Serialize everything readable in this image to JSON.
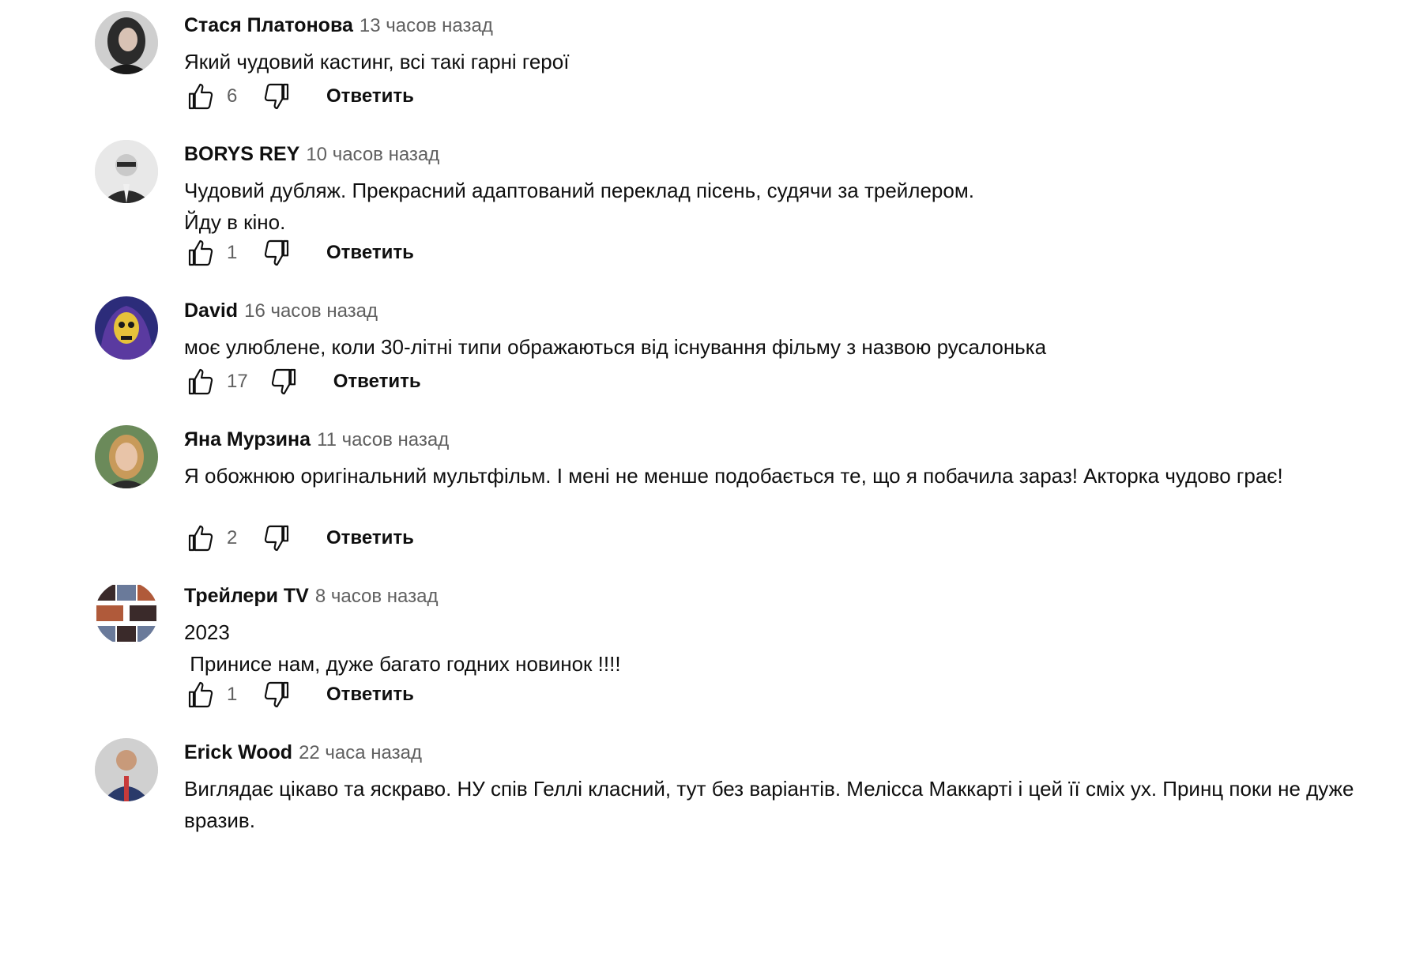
{
  "comments": [
    {
      "author": "Стася Платонова",
      "time": "13 часов назад",
      "text": "Який чудовий кастинг, всі такі гарні герої",
      "likes": "6",
      "reply_label": "Ответить",
      "avatar_colors": [
        "#2b2b2b",
        "#d8c2b4",
        "#1a1a1a"
      ]
    },
    {
      "author": "BORYS REY",
      "time": "10 часов назад",
      "text": "Чудовий дубляж. Прекрасний адаптований переклад пісень, судячи за трейлером.\nЙду в кіно.",
      "likes": "1",
      "reply_label": "Ответить",
      "avatar_colors": [
        "#e8e8e8",
        "#2a2a2a",
        "#7a7a7a"
      ]
    },
    {
      "author": "David",
      "time": "16 часов назад",
      "text": "моє улюблене, коли 30-літні типи ображаються від існування фільму з назвою русалонька",
      "likes": "17",
      "reply_label": "Ответить",
      "avatar_colors": [
        "#2c2c7a",
        "#e6c23a",
        "#5a3aa0"
      ]
    },
    {
      "author": "Яна Мурзина",
      "time": "11 часов назад",
      "text": "Я обожнюю оригінальний мультфільм. І мені не менше подобається те, що я побачила зараз! Акторка чудово грає!",
      "likes": "2",
      "reply_label": "Ответить",
      "avatar_colors": [
        "#6b8a5a",
        "#e8c4a8",
        "#c89a5a"
      ]
    },
    {
      "author": "Трейлери TV",
      "time": "8 часов назад",
      "text": "2023\n Принисе нам, дуже багато годних новинок !!!!",
      "likes": "1",
      "reply_label": "Ответить",
      "avatar_colors": [
        "#3a2a2a",
        "#b05a3a",
        "#6a7a9a"
      ]
    },
    {
      "author": "Erick Wood",
      "time": "22 часа назад",
      "text": "Виглядає цікаво та яскраво. НУ спів Геллі класний, тут без варіантів. Мелісса Маккарті і цей її сміх ух. Принц поки не дуже вразив.",
      "likes": "",
      "reply_label": "",
      "avatar_colors": [
        "#2a3a6a",
        "#c83a3a",
        "#1a1a2a"
      ]
    }
  ]
}
